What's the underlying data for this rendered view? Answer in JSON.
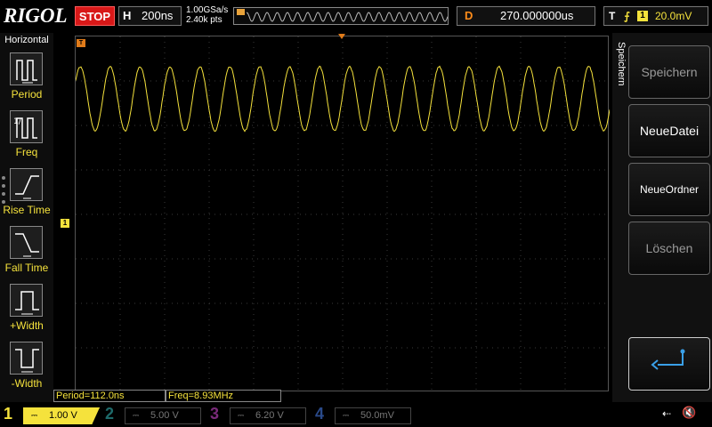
{
  "brand": "RIGOL",
  "topbar": {
    "run_state": "STOP",
    "horizontal": {
      "letter": "H",
      "timebase": "200ns"
    },
    "sample_rate": "1.00GSa/s",
    "memory_depth": "2.40k pts",
    "delay": {
      "letter": "D",
      "value": "270.000000us"
    },
    "trigger": {
      "letter": "T",
      "edge": "⨍",
      "source": "1",
      "level": "20.0mV"
    }
  },
  "left_menu": {
    "title": "Horizontal",
    "items": [
      {
        "label": "Period",
        "icon": "period-icon"
      },
      {
        "label": "Freq",
        "icon": "freq-icon"
      },
      {
        "label": "Rise Time",
        "icon": "rise-time-icon"
      },
      {
        "label": "Fall Time",
        "icon": "fall-time-icon"
      },
      {
        "label": "+Width",
        "icon": "pos-width-icon"
      },
      {
        "label": "-Width",
        "icon": "neg-width-icon"
      }
    ]
  },
  "markers": {
    "ch1": "1",
    "trigger_pos": "T",
    "trig_level": "◂"
  },
  "measurements": [
    {
      "label": "Period=112.0ns"
    },
    {
      "label": "Freq=8.93MHz"
    }
  ],
  "right_menu": {
    "title": "Speichern",
    "softkeys": [
      {
        "label": "Speichern",
        "enabled": false
      },
      {
        "label": "NeueDatei",
        "enabled": true
      },
      {
        "label": "NeueOrdner",
        "enabled": true
      },
      {
        "label": "Löschen",
        "enabled": false
      }
    ],
    "return_icon": "return-arrow-icon"
  },
  "channels": [
    {
      "num": "1",
      "scale": "1.00 V",
      "color": "#f5e23c",
      "active": true
    },
    {
      "num": "2",
      "scale": "5.00 V",
      "color": "#1e8c8c",
      "active": false
    },
    {
      "num": "3",
      "scale": "6.20 V",
      "color": "#9a2a9a",
      "active": false
    },
    {
      "num": "4",
      "scale": "50.0mV",
      "color": "#2a4a9a",
      "active": false
    }
  ],
  "status_icons": {
    "usb": "⇠",
    "speaker": "🔇"
  },
  "colors": {
    "ch1": "#f5e23c",
    "stop": "#d81818",
    "delay": "#ff8c1a",
    "marker": "#e07b1a"
  },
  "waveform": {
    "cycles_on_screen": 17.85,
    "period_ns": 112.0,
    "timebase_ns_per_div": 200
  }
}
